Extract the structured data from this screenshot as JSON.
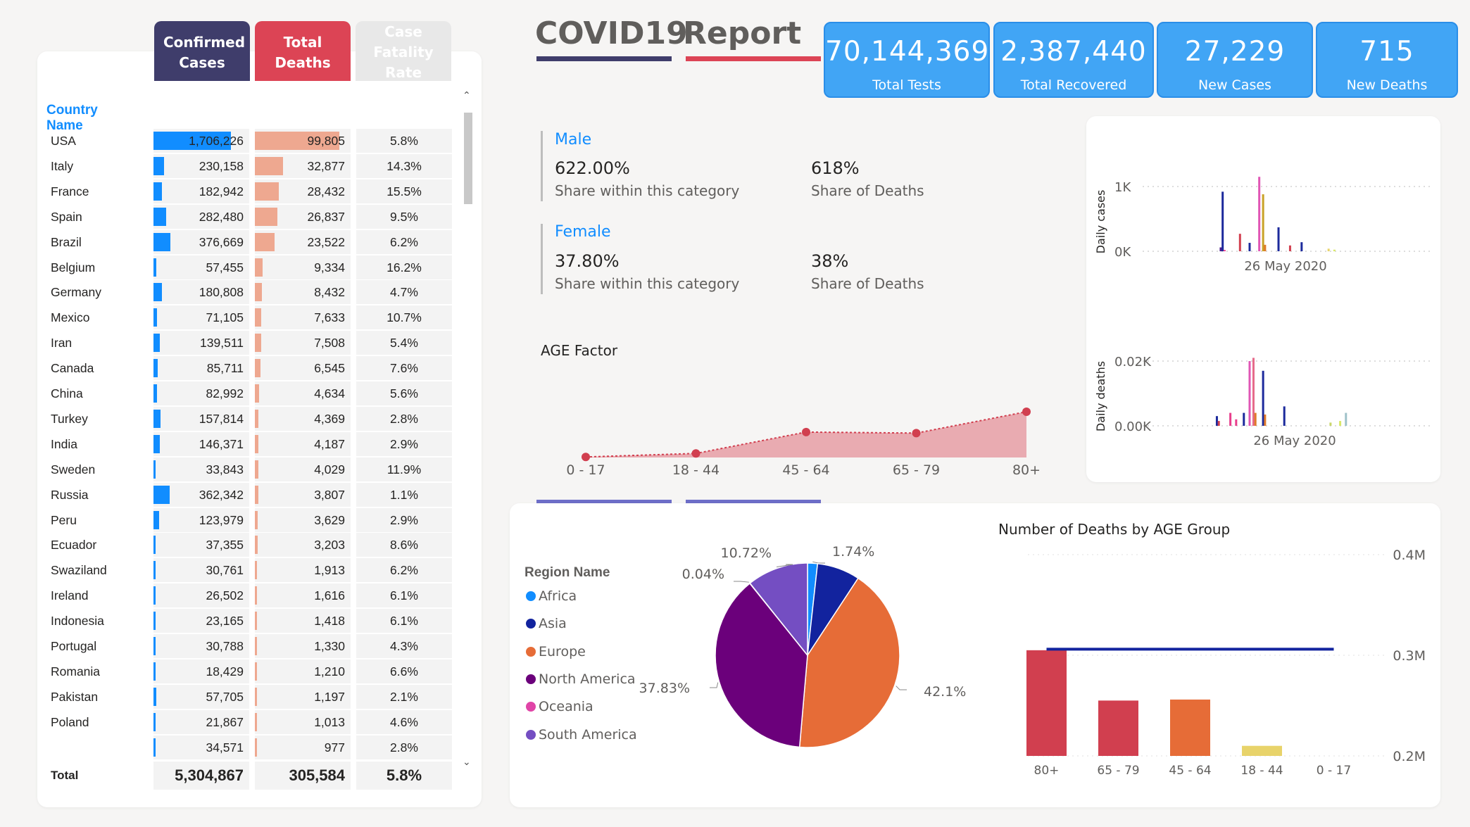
{
  "table": {
    "headers": {
      "confirmed": "Confirmed Cases",
      "deaths": "Total Deaths",
      "cfr": "Case Fatality Rate"
    },
    "country_header": "Country Name",
    "rows": [
      {
        "country": "USA",
        "confirmed": "1,706,226",
        "deaths": "99,805",
        "cfr": "5.8%",
        "c": 1706226,
        "d": 99805
      },
      {
        "country": "Italy",
        "confirmed": "230,158",
        "deaths": "32,877",
        "cfr": "14.3%",
        "c": 230158,
        "d": 32877
      },
      {
        "country": "France",
        "confirmed": "182,942",
        "deaths": "28,432",
        "cfr": "15.5%",
        "c": 182942,
        "d": 28432
      },
      {
        "country": "Spain",
        "confirmed": "282,480",
        "deaths": "26,837",
        "cfr": "9.5%",
        "c": 282480,
        "d": 26837
      },
      {
        "country": "Brazil",
        "confirmed": "376,669",
        "deaths": "23,522",
        "cfr": "6.2%",
        "c": 376669,
        "d": 23522
      },
      {
        "country": "Belgium",
        "confirmed": "57,455",
        "deaths": "9,334",
        "cfr": "16.2%",
        "c": 57455,
        "d": 9334
      },
      {
        "country": "Germany",
        "confirmed": "180,808",
        "deaths": "8,432",
        "cfr": "4.7%",
        "c": 180808,
        "d": 8432
      },
      {
        "country": "Mexico",
        "confirmed": "71,105",
        "deaths": "7,633",
        "cfr": "10.7%",
        "c": 71105,
        "d": 7633
      },
      {
        "country": "Iran",
        "confirmed": "139,511",
        "deaths": "7,508",
        "cfr": "5.4%",
        "c": 139511,
        "d": 7508
      },
      {
        "country": "Canada",
        "confirmed": "85,711",
        "deaths": "6,545",
        "cfr": "7.6%",
        "c": 85711,
        "d": 6545
      },
      {
        "country": "China",
        "confirmed": "82,992",
        "deaths": "4,634",
        "cfr": "5.6%",
        "c": 82992,
        "d": 4634
      },
      {
        "country": "Turkey",
        "confirmed": "157,814",
        "deaths": "4,369",
        "cfr": "2.8%",
        "c": 157814,
        "d": 4369
      },
      {
        "country": "India",
        "confirmed": "146,371",
        "deaths": "4,187",
        "cfr": "2.9%",
        "c": 146371,
        "d": 4187
      },
      {
        "country": "Sweden",
        "confirmed": "33,843",
        "deaths": "4,029",
        "cfr": "11.9%",
        "c": 33843,
        "d": 4029
      },
      {
        "country": "Russia",
        "confirmed": "362,342",
        "deaths": "3,807",
        "cfr": "1.1%",
        "c": 362342,
        "d": 3807
      },
      {
        "country": "Peru",
        "confirmed": "123,979",
        "deaths": "3,629",
        "cfr": "2.9%",
        "c": 123979,
        "d": 3629
      },
      {
        "country": "Ecuador",
        "confirmed": "37,355",
        "deaths": "3,203",
        "cfr": "8.6%",
        "c": 37355,
        "d": 3203
      },
      {
        "country": "Swaziland",
        "confirmed": "30,761",
        "deaths": "1,913",
        "cfr": "6.2%",
        "c": 30761,
        "d": 1913
      },
      {
        "country": "Ireland",
        "confirmed": "26,502",
        "deaths": "1,616",
        "cfr": "6.1%",
        "c": 26502,
        "d": 1616
      },
      {
        "country": "Indonesia",
        "confirmed": "23,165",
        "deaths": "1,418",
        "cfr": "6.1%",
        "c": 23165,
        "d": 1418
      },
      {
        "country": "Portugal",
        "confirmed": "30,788",
        "deaths": "1,330",
        "cfr": "4.3%",
        "c": 30788,
        "d": 1330
      },
      {
        "country": "Romania",
        "confirmed": "18,429",
        "deaths": "1,210",
        "cfr": "6.6%",
        "c": 18429,
        "d": 1210
      },
      {
        "country": "Pakistan",
        "confirmed": "57,705",
        "deaths": "1,197",
        "cfr": "2.1%",
        "c": 57705,
        "d": 1197
      },
      {
        "country": "Poland",
        "confirmed": "21,867",
        "deaths": "1,013",
        "cfr": "4.6%",
        "c": 21867,
        "d": 1013
      },
      {
        "country": "",
        "confirmed": "34,571",
        "deaths": "977",
        "cfr": "2.8%",
        "c": 34571,
        "d": 977
      }
    ],
    "total": {
      "label": "Total",
      "confirmed": "5,304,867",
      "deaths": "305,584",
      "cfr": "5.8%"
    },
    "colors": {
      "confirmed_bar": "#118dff",
      "deaths_bar": "#eea890"
    }
  },
  "title": {
    "part1": "COVID19",
    "part2": "Report"
  },
  "kpis": [
    {
      "value": "70,144,369",
      "label": "Total Tests"
    },
    {
      "value": "2,387,440",
      "label": "Total Recovered"
    },
    {
      "value": "27,229",
      "label": "New Cases"
    },
    {
      "value": "715",
      "label": "New Deaths"
    }
  ],
  "gender": {
    "male": {
      "title": "Male",
      "share": "622.00%",
      "share_label": "Share within this category",
      "deaths_share": "618%",
      "deaths_label": "Share of Deaths"
    },
    "female": {
      "title": "Female",
      "share": "37.80%",
      "share_label": "Share within this category",
      "deaths_share": "38%",
      "deaths_label": "Share of Deaths"
    }
  },
  "chart_data": [
    {
      "type": "area",
      "title": "AGE Factor",
      "categories": [
        "0 - 17",
        "18 - 44",
        "45 - 64",
        "65 - 79",
        "80+"
      ],
      "values": [
        0.5,
        4,
        25,
        24,
        45
      ],
      "color": "#d13f4f"
    },
    {
      "type": "bar",
      "ylabel": "Daily cases",
      "yticks": [
        "1K",
        "0K"
      ],
      "xlabel": "26 May 2020",
      "ylim": [
        0,
        1000
      ],
      "bars": [
        {
          "x": 0.4,
          "value": 60,
          "color": "#4b1b8c"
        },
        {
          "x": 0.41,
          "value": 920,
          "color": "#1c2a9c"
        },
        {
          "x": 0.42,
          "value": 20,
          "color": "#e83e8c"
        },
        {
          "x": 0.5,
          "value": 270,
          "color": "#d13f4f"
        },
        {
          "x": 0.55,
          "value": 130,
          "color": "#1c2a9c"
        },
        {
          "x": 0.6,
          "value": 1150,
          "color": "#e056b5"
        },
        {
          "x": 0.62,
          "value": 880,
          "color": "#c9a227"
        },
        {
          "x": 0.63,
          "value": 100,
          "color": "#e07a2a"
        },
        {
          "x": 0.7,
          "value": 370,
          "color": "#1c2a9c"
        },
        {
          "x": 0.76,
          "value": 90,
          "color": "#d13f4f"
        },
        {
          "x": 0.82,
          "value": 140,
          "color": "#1c2a9c"
        },
        {
          "x": 0.96,
          "value": 40,
          "color": "#e8d36a"
        },
        {
          "x": 0.99,
          "value": 25,
          "color": "#d9e86a"
        }
      ]
    },
    {
      "type": "bar",
      "ylabel": "Daily deaths",
      "yticks": [
        "0.02K",
        "0.00K"
      ],
      "xlabel": "26 May 2020",
      "ylim": [
        0,
        20
      ],
      "bars": [
        {
          "x": 0.38,
          "value": 3,
          "color": "#1c2a9c"
        },
        {
          "x": 0.39,
          "value": 1.5,
          "color": "#d13f4f"
        },
        {
          "x": 0.45,
          "value": 4,
          "color": "#e83e8c"
        },
        {
          "x": 0.48,
          "value": 2,
          "color": "#e83e8c"
        },
        {
          "x": 0.52,
          "value": 4,
          "color": "#1c2a9c"
        },
        {
          "x": 0.55,
          "value": 20,
          "color": "#e056b5"
        },
        {
          "x": 0.57,
          "value": 21,
          "color": "#e56a8a"
        },
        {
          "x": 0.58,
          "value": 4,
          "color": "#e07a2a"
        },
        {
          "x": 0.62,
          "value": 17,
          "color": "#1c2a9c"
        },
        {
          "x": 0.63,
          "value": 3.5,
          "color": "#e07a2a"
        },
        {
          "x": 0.73,
          "value": 6,
          "color": "#1c2a9c"
        },
        {
          "x": 0.97,
          "value": 1,
          "color": "#c9d66a"
        },
        {
          "x": 1.02,
          "value": 1.5,
          "color": "#d9e86a"
        },
        {
          "x": 1.05,
          "value": 4,
          "color": "#9fc2c9"
        }
      ]
    },
    {
      "type": "pie",
      "legend_title": "Region Name",
      "slices": [
        {
          "name": "Africa",
          "value": 1.74,
          "label": "1.74%",
          "color": "#118dff"
        },
        {
          "name": "Asia",
          "value": 7.5,
          "label": "",
          "color": "#12239e"
        },
        {
          "name": "Europe",
          "value": 42.1,
          "label": "42.1%",
          "color": "#e66c37"
        },
        {
          "name": "North America",
          "value": 37.83,
          "label": "37.83%",
          "color": "#6b007b"
        },
        {
          "name": "Oceania",
          "value": 0.04,
          "label": "0.04%",
          "color": "#e044a7"
        },
        {
          "name": "South America",
          "value": 10.72,
          "label": "10.72%",
          "color": "#744ec2"
        }
      ]
    },
    {
      "type": "bar",
      "title": "Number of Deaths by AGE Group",
      "categories": [
        "80+",
        "65 - 79",
        "45 - 64",
        "18 - 44",
        "0 - 17"
      ],
      "values": [
        0.305,
        0.255,
        0.256,
        0.21,
        0.0
      ],
      "colors": [
        "#d13f4f",
        "#d13f4f",
        "#e66c37",
        "#e8d36a",
        "#d13f4f"
      ],
      "yticks": [
        "0.4M",
        "0.3M",
        "0.2M"
      ],
      "ylim": [
        0.2,
        0.4
      ],
      "line_value": 0.306,
      "line_color": "#12239e"
    }
  ]
}
